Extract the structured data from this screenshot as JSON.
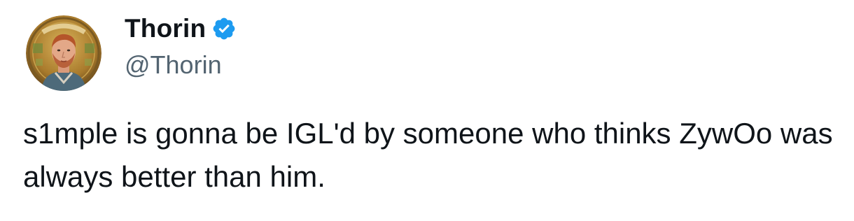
{
  "author": {
    "display_name": "Thorin",
    "handle": "@Thorin",
    "verified": true,
    "avatar_icon": "profile-portrait-avatar",
    "verified_icon": "verified-badge-icon"
  },
  "tweet": {
    "text": "s1mple is gonna be IGL'd by someone who thinks ZywOo was always better than him."
  },
  "colors": {
    "background": "#ffffff",
    "text_primary": "#0f1419",
    "text_secondary": "#536471",
    "verified_blue": "#1d9bf0"
  }
}
